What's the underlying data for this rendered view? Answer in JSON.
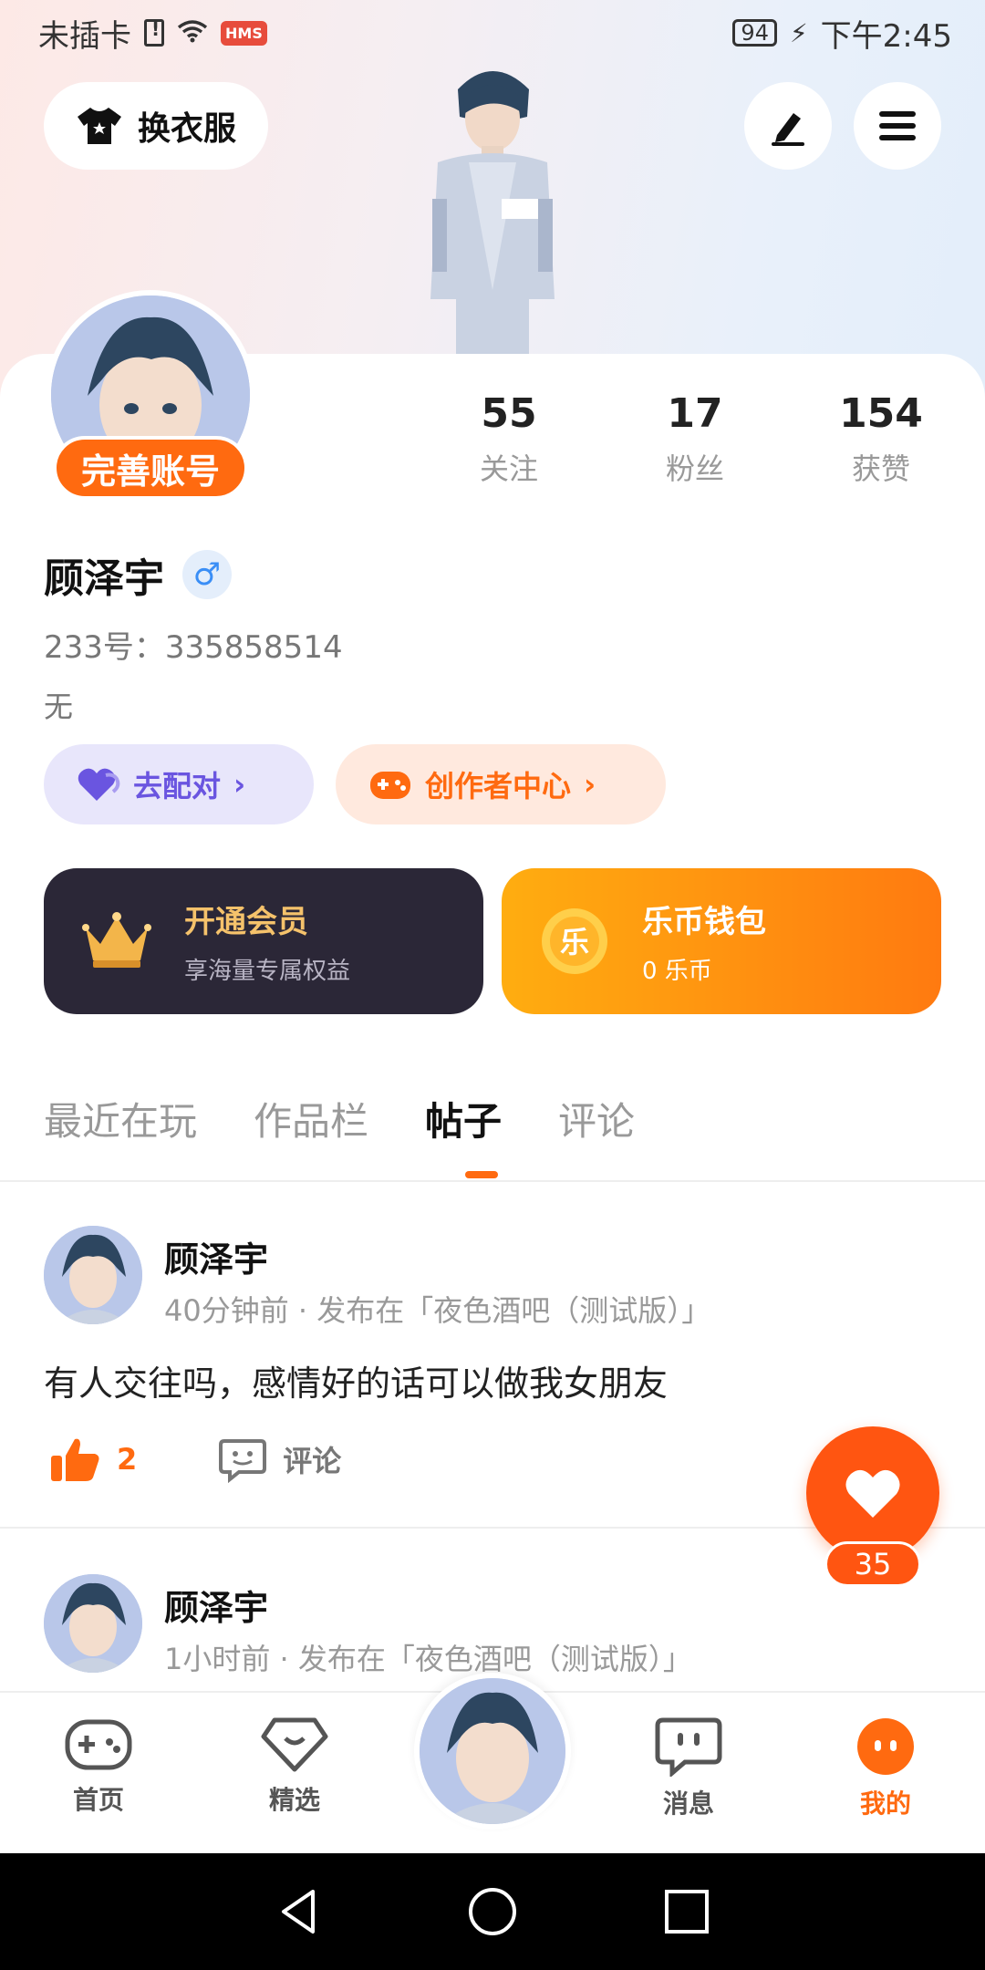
{
  "status_bar": {
    "carrier": "未插卡",
    "hms": "HMS",
    "battery": "94",
    "time": "下午2:45"
  },
  "header": {
    "outfit_label": "换衣服"
  },
  "profile": {
    "perfect_account": "完善账号",
    "stats": [
      {
        "value": "55",
        "label": "关注"
      },
      {
        "value": "17",
        "label": "粉丝"
      },
      {
        "value": "154",
        "label": "获赞"
      }
    ],
    "username": "顾泽宇",
    "gender_symbol": "♂",
    "user_id": "233号：335858514",
    "bio": "无",
    "match_label": "去配对",
    "creator_label": "创作者中心"
  },
  "promos": {
    "vip_title": "开通会员",
    "vip_sub": "享海量专属权益",
    "wallet_title": "乐币钱包",
    "wallet_sub": "0 乐币",
    "wallet_coin": "乐"
  },
  "tabs": [
    "最近在玩",
    "作品栏",
    "帖子",
    "评论"
  ],
  "active_tab": "帖子",
  "posts": [
    {
      "author": "顾泽宇",
      "meta": "40分钟前 · 发布在「夜色酒吧（测试版）」",
      "text": "有人交往吗，感情好的话可以做我女朋友",
      "likes": "2",
      "comment_label": "评论"
    },
    {
      "author": "顾泽宇",
      "meta": "1小时前 · 发布在「夜色酒吧（测试版）」"
    }
  ],
  "float_like": {
    "count": "35"
  },
  "bottom_nav": [
    {
      "label": "首页"
    },
    {
      "label": "精选"
    },
    {
      "label": "消息"
    },
    {
      "label": "我的"
    }
  ],
  "colors": {
    "accent": "#ff6a10",
    "match_purple": "#6a55e0",
    "vip_dark": "#2b2737"
  }
}
